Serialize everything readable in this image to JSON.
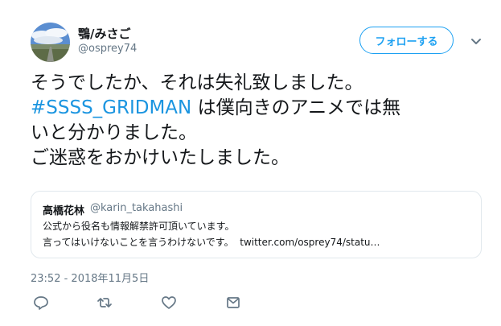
{
  "author": {
    "display_name": "鶚/みさご",
    "handle": "@osprey74"
  },
  "header": {
    "follow_label": "フォローする"
  },
  "tweet": {
    "line1": "そうでしたか、それは失礼致しました。",
    "hashtag": "#SSSS_GRIDMAN",
    "line2_rest": " は僕向きのアニメでは無",
    "line3": "いと分かりました。",
    "line4": "ご迷惑をおかけいたしました。"
  },
  "quote": {
    "name": "高橋花林",
    "handle": "@karin_takahashi",
    "line1": "公式から役名も情報解禁許可頂いています。",
    "line2": "言ってはいけないことを言うわけないです。",
    "link": "twitter.com/osprey74/statu…"
  },
  "timestamp": "23:52 - 2018年11月5日",
  "icons": {
    "reply": "reply-icon",
    "retweet": "retweet-icon",
    "like": "like-icon",
    "dm": "dm-icon"
  },
  "colors": {
    "accent": "#1da1f2",
    "hashtag": "#1b95e0",
    "secondary_text": "#657786",
    "border": "#e1e8ed"
  }
}
